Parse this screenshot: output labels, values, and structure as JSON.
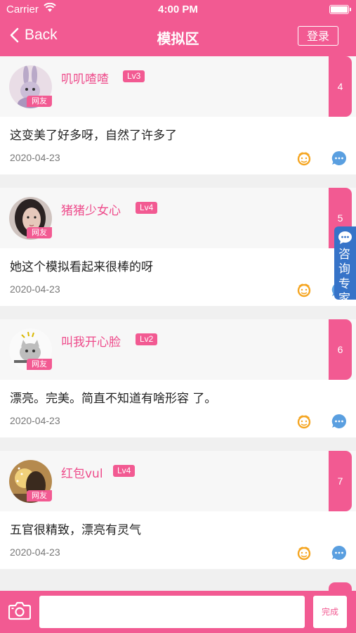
{
  "status": {
    "carrier": "Carrier",
    "time": "4:00 PM"
  },
  "nav": {
    "back_label": "Back",
    "title": "模拟区",
    "login_label": "登录"
  },
  "posts": [
    {
      "username": "叽叽喳喳",
      "level": "Lv3",
      "tag": "网友",
      "floor": "4",
      "content": "这变美了好多呀，自然了许多了",
      "date": "2020-04-23"
    },
    {
      "username": "猪猪少女心",
      "level": "Lv4",
      "tag": "网友",
      "floor": "5",
      "content": "她这个模拟看起来很棒的呀",
      "date": "2020-04-23"
    },
    {
      "username": "叫我开心脸",
      "level": "Lv2",
      "tag": "网友",
      "floor": "6",
      "content": "漂亮。完美。简直不知道有啥形容 了。",
      "date": "2020-04-23"
    },
    {
      "username": "红包vul",
      "level": "Lv4",
      "tag": "网友",
      "floor": "7",
      "content": "五官很精致，漂亮有灵气",
      "date": "2020-04-23"
    }
  ],
  "consult": {
    "label": "咨询专家"
  },
  "composer": {
    "placeholder": "",
    "done_label": "完成"
  },
  "colors": {
    "brand": "#f25a92",
    "consult": "#3673c8",
    "mascot": "#f5a623",
    "bubble": "#5a9fe0"
  }
}
